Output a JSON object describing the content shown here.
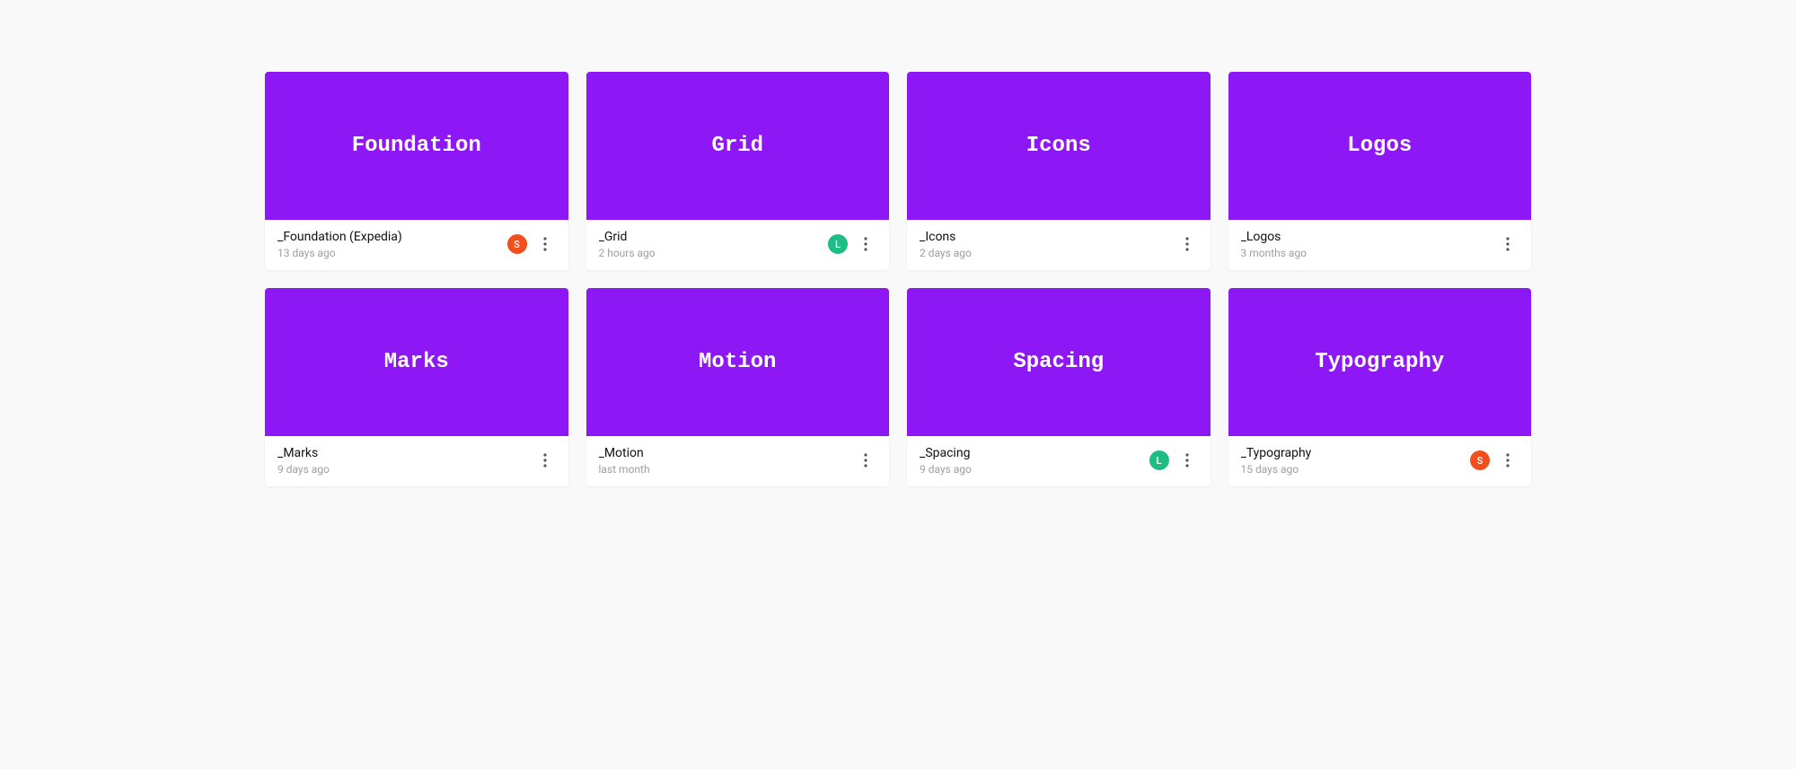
{
  "colors": {
    "thumb_bg": "#8e18f5",
    "avatar_red": "#f24e1e",
    "avatar_green": "#1dbd83"
  },
  "files": [
    {
      "thumb_label": "Foundation",
      "name": "_Foundation (Expedia)",
      "timestamp": "13 days ago",
      "avatar": {
        "letter": "S",
        "color": "red"
      }
    },
    {
      "thumb_label": "Grid",
      "name": "_Grid",
      "timestamp": "2 hours ago",
      "avatar": {
        "letter": "L",
        "color": "green"
      }
    },
    {
      "thumb_label": "Icons",
      "name": "_Icons",
      "timestamp": "2 days ago",
      "avatar": null
    },
    {
      "thumb_label": "Logos",
      "name": "_Logos",
      "timestamp": "3 months ago",
      "avatar": null
    },
    {
      "thumb_label": "Marks",
      "name": "_Marks",
      "timestamp": "9 days ago",
      "avatar": null
    },
    {
      "thumb_label": "Motion",
      "name": "_Motion",
      "timestamp": "last month",
      "avatar": null
    },
    {
      "thumb_label": "Spacing",
      "name": "_Spacing",
      "timestamp": "9 days ago",
      "avatar": {
        "letter": "L",
        "color": "green"
      }
    },
    {
      "thumb_label": "Typography",
      "name": "_Typography",
      "timestamp": "15 days ago",
      "avatar": {
        "letter": "S",
        "color": "red"
      }
    }
  ]
}
